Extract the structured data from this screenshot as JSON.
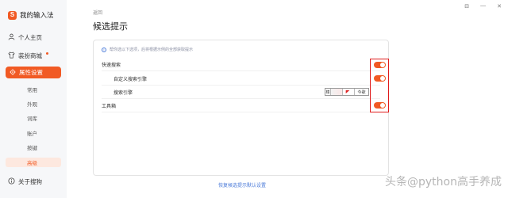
{
  "app": {
    "title": "我的输入法",
    "logo_char": "S"
  },
  "window": {
    "settings_glyph": "⊟",
    "minimize_glyph": "—",
    "close_glyph": "✕"
  },
  "sidebar": {
    "top_items": [
      {
        "label": "个人主页",
        "icon": "user-icon"
      },
      {
        "label": "装扮商城",
        "icon": "shirt-icon",
        "has_dot": true
      }
    ],
    "active_item": {
      "label": "属性设置",
      "icon": "gear-icon"
    },
    "sub_items": [
      "常用",
      "外观",
      "词库",
      "账户",
      "按键",
      "高级"
    ],
    "selected_sub_item": "高级",
    "bottom_item": {
      "label": "关于搜狗",
      "icon": "info-icon"
    }
  },
  "header": {
    "back_label": "返回",
    "title": "候选提示"
  },
  "panel": {
    "tip_text": "帮你选以下选项，后将根据示例的全部获取提示",
    "rows": [
      {
        "label": "快速搜索",
        "toggle": true
      },
      {
        "label": "自定义搜索引擎",
        "toggle": true
      },
      {
        "label": "搜索引擎",
        "segments": [
          "楼",
          "",
          "",
          "今歌"
        ]
      },
      {
        "label": "工具箱",
        "toggle": true
      }
    ]
  },
  "footer": {
    "restore_label": "恢复候选提示默认设置"
  },
  "watermark": "头条@python高手养成",
  "colors": {
    "accent": "#f15a24",
    "highlight": "#e01b1b",
    "link": "#4a7ad9"
  }
}
